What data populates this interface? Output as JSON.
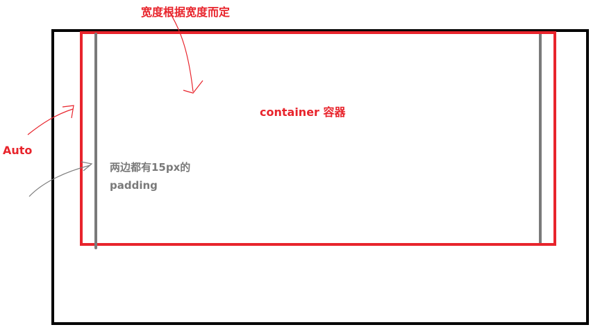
{
  "labels": {
    "width_note": "宽度根据宽度而定",
    "container": "container 容器",
    "auto": "Auto",
    "padding_line1": "两边都有15px的",
    "padding_line2": "padding"
  },
  "colors": {
    "outer_box": "#000000",
    "container_box": "#e8242c",
    "padding_lines": "#7a7a7a",
    "annotation_red": "#e8242c",
    "annotation_gray": "#7a7a7a",
    "background": "#ffffff"
  }
}
